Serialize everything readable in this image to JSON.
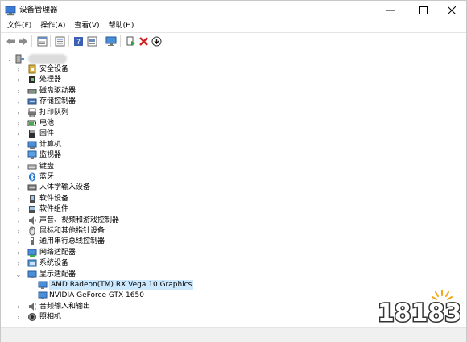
{
  "window": {
    "title": "设备管理器"
  },
  "menu": [
    {
      "label": "文件(F)"
    },
    {
      "label": "操作(A)"
    },
    {
      "label": "查看(V)"
    },
    {
      "label": "帮助(H)"
    }
  ],
  "toolbar": {
    "icons": [
      "back-icon",
      "forward-icon",
      "properties-icon",
      "view-icon",
      "help-icon",
      "scan-icon",
      "monitor-icon",
      "update-driver-icon",
      "uninstall-icon",
      "disable-icon"
    ]
  },
  "tree": {
    "root": {
      "label": ""
    },
    "categories": [
      {
        "label": "安全设备",
        "icon": "security-device-icon"
      },
      {
        "label": "处理器",
        "icon": "processor-icon"
      },
      {
        "label": "磁盘驱动器",
        "icon": "disk-drive-icon"
      },
      {
        "label": "存储控制器",
        "icon": "storage-controller-icon"
      },
      {
        "label": "打印队列",
        "icon": "print-queue-icon"
      },
      {
        "label": "电池",
        "icon": "battery-icon"
      },
      {
        "label": "固件",
        "icon": "firmware-icon"
      },
      {
        "label": "计算机",
        "icon": "computer-icon"
      },
      {
        "label": "监视器",
        "icon": "monitor-icon"
      },
      {
        "label": "键盘",
        "icon": "keyboard-icon"
      },
      {
        "label": "蓝牙",
        "icon": "bluetooth-icon"
      },
      {
        "label": "人体学输入设备",
        "icon": "hid-icon"
      },
      {
        "label": "软件设备",
        "icon": "software-device-icon"
      },
      {
        "label": "软件组件",
        "icon": "software-component-icon"
      },
      {
        "label": "声音、视频和游戏控制器",
        "icon": "sound-icon"
      },
      {
        "label": "鼠标和其他指针设备",
        "icon": "mouse-icon"
      },
      {
        "label": "通用串行总线控制器",
        "icon": "usb-icon"
      },
      {
        "label": "网络适配器",
        "icon": "network-adapter-icon"
      },
      {
        "label": "系统设备",
        "icon": "system-device-icon"
      },
      {
        "label": "显示适配器",
        "icon": "display-adapter-icon",
        "expanded": true,
        "children": [
          {
            "label": "AMD Radeon(TM) RX Vega 10 Graphics",
            "selected": true
          },
          {
            "label": "NVIDIA GeForce GTX 1650"
          }
        ]
      },
      {
        "label": "音频输入和输出",
        "icon": "audio-io-icon"
      },
      {
        "label": "照相机",
        "icon": "camera-icon"
      }
    ]
  },
  "watermark": {
    "text": "18183"
  },
  "colors": {
    "selection": "#cce8ff",
    "accent": "#0078d7"
  }
}
